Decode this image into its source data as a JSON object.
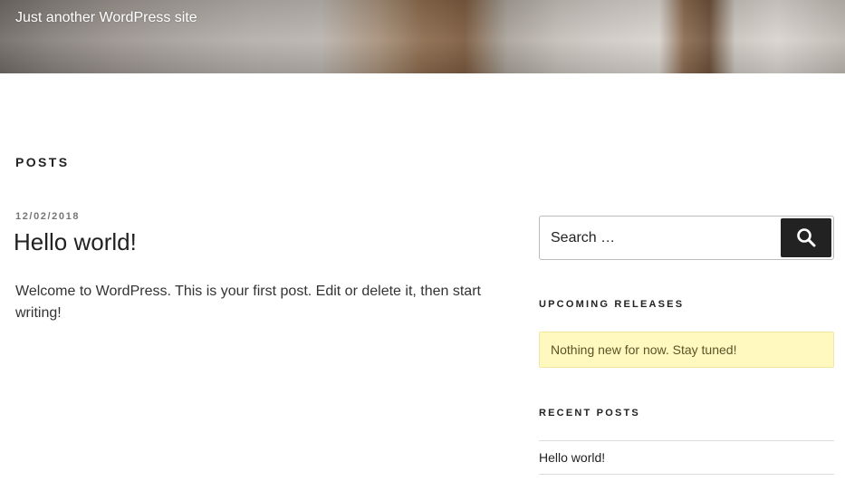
{
  "site": {
    "tagline": "Just another WordPress site"
  },
  "main": {
    "section_title": "POSTS",
    "posts": [
      {
        "date": "12/02/2018",
        "title": "Hello world!",
        "excerpt": "Welcome to WordPress. This is your first post. Edit or delete it, then start writing!"
      }
    ]
  },
  "sidebar": {
    "search": {
      "placeholder": "Search …",
      "button_icon": "search-icon"
    },
    "upcoming": {
      "title": "UPCOMING RELEASES",
      "message": "Nothing new for now. Stay tuned!"
    },
    "recent": {
      "title": "RECENT POSTS",
      "items": [
        {
          "label": "Hello world!"
        }
      ]
    }
  },
  "colors": {
    "notice_bg": "#fff9c0",
    "button_bg": "#222222",
    "text": "#222222"
  }
}
